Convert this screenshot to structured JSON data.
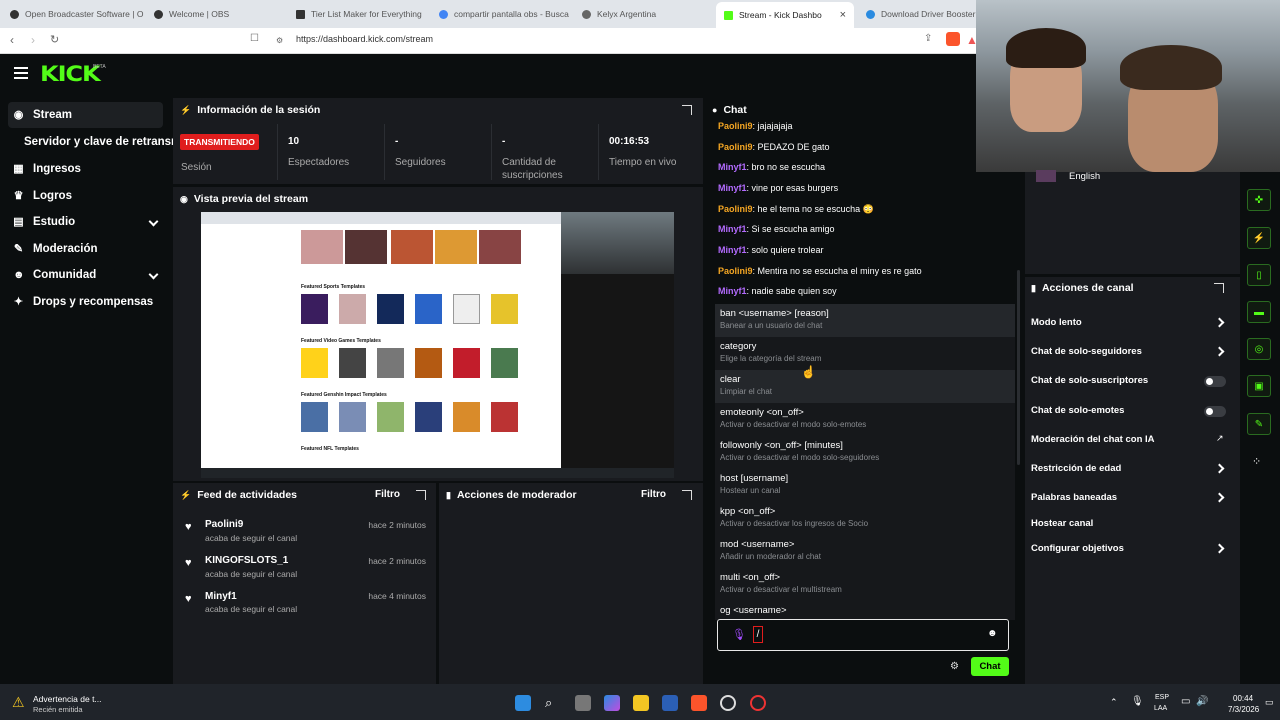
{
  "browser": {
    "tabs": [
      {
        "label": "Open Broadcaster Software | O"
      },
      {
        "label": "Welcome | OBS"
      },
      {
        "label": "Tier List Maker for Everything"
      },
      {
        "label": "compartir pantalla obs - Busca"
      },
      {
        "label": "Kelyx Argentina"
      },
      {
        "label": "Stream - Kick Dashbo"
      },
      {
        "label": "Download Driver Booster"
      }
    ],
    "url": "https://dashboard.kick.com/stream"
  },
  "header": {
    "logo": "KICK",
    "beta": "BETA"
  },
  "sidebar": {
    "items": [
      {
        "label": "Stream",
        "icon": "stream-icon"
      },
      {
        "label": "Servidor y clave de retransm"
      },
      {
        "label": "Ingresos",
        "icon": "chart-icon"
      },
      {
        "label": "Logros",
        "icon": "trophy-icon"
      },
      {
        "label": "Estudio",
        "icon": "studio-icon"
      },
      {
        "label": "Moderación",
        "icon": "wrench-icon"
      },
      {
        "label": "Comunidad",
        "icon": "people-icon"
      },
      {
        "label": "Drops y recompensas",
        "icon": "gift-icon"
      }
    ]
  },
  "session": {
    "title": "Información de la sesión",
    "badge": "TRANSMITIENDO",
    "stats": [
      {
        "value": "",
        "label": "Sesión"
      },
      {
        "value": "10",
        "label": "Espectadores"
      },
      {
        "value": "-",
        "label": "Seguidores"
      },
      {
        "value": "-",
        "label": "Cantidad de suscripciones"
      },
      {
        "value": "00:16:53",
        "label": "Tiempo en vivo"
      }
    ]
  },
  "preview": {
    "title": "Vista previa del stream",
    "sections": [
      "Featured Sports Templates",
      "Featured Video Games Templates",
      "Featured Genshin Impact Templates",
      "Featured NFL Templates"
    ]
  },
  "feed": {
    "title": "Feed de actividades",
    "filter": "Filtro",
    "items": [
      {
        "name": "Paolini9",
        "action": "acaba de seguir el canal",
        "time": "hace 2 minutos"
      },
      {
        "name": "KINGOFSLOTS_1",
        "action": "acaba de seguir el canal",
        "time": "hace 2 minutos"
      },
      {
        "name": "Minyf1",
        "action": "acaba de seguir el canal",
        "time": "hace 4 minutos"
      }
    ]
  },
  "modactions": {
    "title": "Acciones de moderador",
    "filter": "Filtro"
  },
  "chat": {
    "title": "Chat",
    "messages": [
      {
        "user": "Paolini9",
        "text": ": jajajajaja",
        "color": "#f5a623"
      },
      {
        "user": "Paolini9",
        "text": ": PEDAZO DE gato",
        "color": "#f5a623"
      },
      {
        "user": "Minyf1",
        "text": ": bro no se escucha",
        "color": "#b36bff"
      },
      {
        "user": "Minyf1",
        "text": ": vine por esas burgers",
        "color": "#b36bff"
      },
      {
        "user": "Paolini9",
        "text": ": he el tema no se escucha 😳",
        "color": "#f5a623"
      },
      {
        "user": "Minyf1",
        "text": ": Si se escucha amigo",
        "color": "#b36bff"
      },
      {
        "user": "Minyf1",
        "text": ": solo quiere trolear",
        "color": "#b36bff"
      },
      {
        "user": "Paolini9",
        "text": ": Mentira no se escucha el minу es re gato",
        "color": "#f5a623"
      },
      {
        "user": "Minyf1",
        "text": ": nadie sabe quien soy",
        "color": "#b36bff"
      }
    ],
    "commands": [
      {
        "name": "ban <username> [reason]",
        "desc": "Banear a un usuario del chat"
      },
      {
        "name": "category",
        "desc": "Elige la categoría del stream"
      },
      {
        "name": "clear",
        "desc": "Limpiar el chat"
      },
      {
        "name": "emoteonly <on_off>",
        "desc": "Activar o desactivar el modo solo-emotes"
      },
      {
        "name": "followonly <on_off> [minutes]",
        "desc": "Activar o desactivar el modo solo-seguidores"
      },
      {
        "name": "host [username]",
        "desc": "Hostear un canal"
      },
      {
        "name": "kpp <on_off>",
        "desc": "Activar o desactivar los ingresos de Socio"
      },
      {
        "name": "mod <username>",
        "desc": "Añadir un moderador al chat"
      },
      {
        "name": "multi <on_off>",
        "desc": "Activar o desactivar el multistream"
      },
      {
        "name": "og <username>",
        "desc": ""
      }
    ],
    "input_value": "/",
    "send_label": "Chat"
  },
  "language": "English",
  "channel_actions": {
    "title": "Acciones de canal",
    "items": [
      {
        "label": "Modo lento",
        "control": "chevron"
      },
      {
        "label": "Chat de solo-seguidores",
        "control": "chevron"
      },
      {
        "label": "Chat de solo-suscriptores",
        "control": "toggle",
        "on": false
      },
      {
        "label": "Chat de solo-emotes",
        "control": "toggle",
        "on": false
      },
      {
        "label": "Moderación del chat con IA",
        "control": "external"
      },
      {
        "label": "Restricción de edad",
        "control": "chevron"
      },
      {
        "label": "Palabras baneadas",
        "control": "chevron"
      },
      {
        "label": "Hostear canal",
        "control": "none"
      },
      {
        "label": "Configurar objetivos",
        "control": "chevron"
      }
    ]
  },
  "taskbar": {
    "notification_title": "Advertencia de t...",
    "notification_sub": "Recién emitida",
    "lang_top": "ESP",
    "lang_bottom": "LAA",
    "time": "00:44",
    "date": "7/3/2026"
  },
  "colors": {
    "accent": "#53fc18",
    "live": "#e01d1d",
    "panel": "#191b1f",
    "bg": "#0b0e0f"
  }
}
